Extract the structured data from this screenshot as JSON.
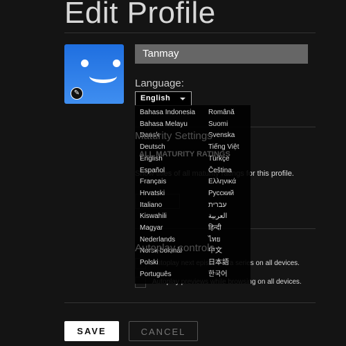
{
  "title": "Edit Profile",
  "profile": {
    "name": "Tanmay",
    "language_label": "Language:",
    "language_value": "English"
  },
  "background": {
    "maturity_heading": "Maturity Settings",
    "maturity_rating": "ALL MATURITY RATINGS",
    "maturity_desc": "Show titles of all maturity ratings for this profile.",
    "autoplay_heading": "Autoplay controls",
    "autoplay_next": "Autoplay next episode in a series on all devices.",
    "autoplay_previews": "Autoplay previews while browsing on all devices."
  },
  "languages_col1": [
    "Bahasa Indonesia",
    "Bahasa Melayu",
    "Dansk",
    "Deutsch",
    "English",
    "Español",
    "Français",
    "Hrvatski",
    "Italiano",
    "Kiswahili",
    "Magyar",
    "Nederlands",
    "Norsk bokmål",
    "Polski",
    "Português"
  ],
  "languages_col2": [
    "Română",
    "Suomi",
    "Svenska",
    "Tiếng Việt",
    "Türkçe",
    "Čeština",
    "Ελληνικά",
    "Русский",
    "עברית",
    "العربية",
    "हिन्दी",
    "ไทย",
    "中文",
    "日本語",
    "한국어"
  ],
  "buttons": {
    "save": "SAVE",
    "cancel": "CANCEL"
  }
}
